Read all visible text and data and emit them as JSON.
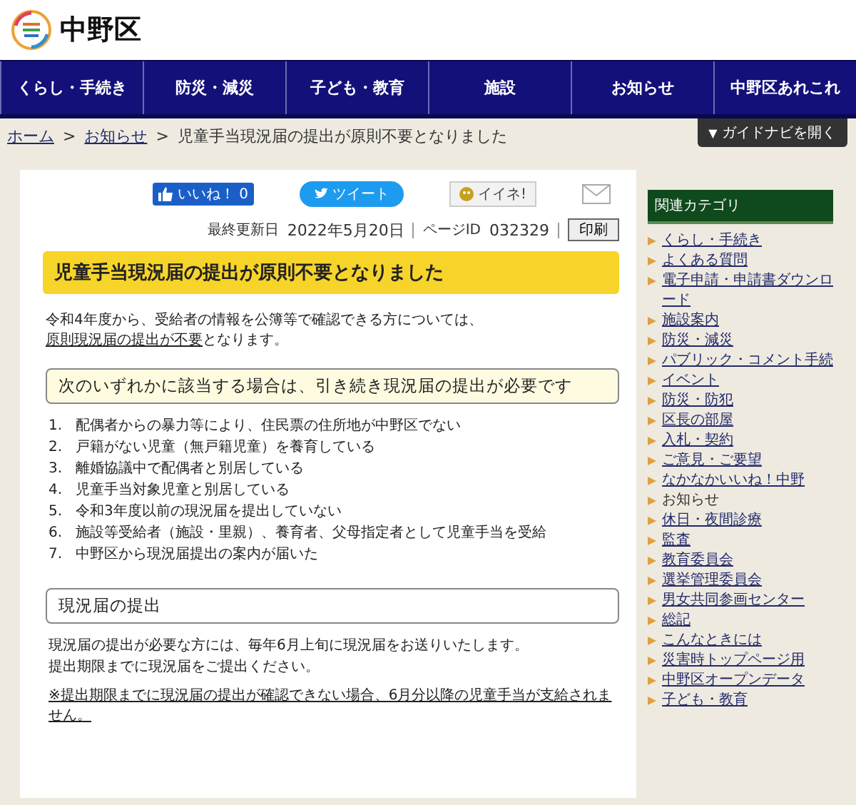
{
  "header": {
    "logo_text": "中野区"
  },
  "nav": [
    {
      "label": "くらし・手続き"
    },
    {
      "label": "防災・減災"
    },
    {
      "label": "子ども・教育"
    },
    {
      "label": "施設"
    },
    {
      "label": "お知らせ"
    },
    {
      "label": "中野区あれこれ"
    }
  ],
  "breadcrumb": [
    {
      "label": "ホーム",
      "kind": "link"
    },
    {
      "label": "お知らせ",
      "kind": "link",
      "separator": ">"
    },
    {
      "label": "児童手当現況届の提出が原則不要となりました",
      "kind": "current",
      "separator": ">"
    }
  ],
  "guide_button": {
    "icon": "▼",
    "label": "ガイドナビを開く"
  },
  "share": {
    "like_label": "いいね！",
    "like_count": "0",
    "tweet": "ツイート",
    "mixi": "イイネ!"
  },
  "meta": {
    "updated_label": "最終更新日",
    "updated": "2022年5月20日",
    "page_id_label": "ページID",
    "page_id": "032329",
    "print_button": "印刷"
  },
  "title": "児童手当現況届の提出が原則不要となりました",
  "intro": [
    {
      "text": "令和4年度から、受給者の情報を公簿等で確認できる方については、",
      "kind": "text"
    },
    {
      "text": "原則現況届の提出が不要",
      "kind": "link"
    },
    {
      "text": "となります。",
      "kind": "text"
    }
  ],
  "sections": [
    {
      "heading": "次のいずれかに該当する場合は、引き続き現況届の提出が必要です",
      "kind": "highlight",
      "items": [
        {
          "number": "1.",
          "text": "配偶者からの暴力等により、住民票の住所地が中野区でない"
        },
        {
          "number": "2.",
          "text": "戸籍がない児童（無戸籍児童）を養育している"
        },
        {
          "number": "3.",
          "text": "離婚協議中で配偶者と別居している"
        },
        {
          "number": "4.",
          "text": "児童手当対象児童と別居している"
        },
        {
          "number": "5.",
          "text": "令和3年度以前の現況届を提出していない"
        },
        {
          "number": "6.",
          "text": "施設等受給者（施設・里親）、養育者、父母指定者として児童手当を受給"
        },
        {
          "number": "7.",
          "text": "中野区から現況届提出の案内が届いた"
        }
      ]
    },
    {
      "heading": "現況届の提出",
      "kind": "plain",
      "paragraphs": [
        "現況届の提出が必要な方には、毎年6月上旬に現況届をお送りいたします。",
        "提出期限までに現況届をご提出ください。"
      ],
      "note": "※提出期限までに現況届の提出が確認できない場合、6月分以降の児童手当が支給されません。"
    }
  ],
  "sidebar": {
    "title": "関連カテゴリ",
    "items": [
      {
        "label": "くらし・手続き",
        "selected": false
      },
      {
        "label": "よくある質問",
        "selected": false
      },
      {
        "label": "電子申請・申請書ダウンロード",
        "selected": false
      },
      {
        "label": "施設案内",
        "selected": false
      },
      {
        "label": "防災・減災",
        "selected": false
      },
      {
        "label": "パブリック・コメント手続",
        "selected": false
      },
      {
        "label": "イベント",
        "selected": false
      },
      {
        "label": "防災・防犯",
        "selected": false
      },
      {
        "label": "区長の部屋",
        "selected": false
      },
      {
        "label": "入札・契約",
        "selected": false
      },
      {
        "label": "ご意見・ご要望",
        "selected": false
      },
      {
        "label": "なかなかいいね！中野",
        "selected": false
      },
      {
        "label": "お知らせ",
        "selected": true
      },
      {
        "label": "休日・夜間診療",
        "selected": false
      },
      {
        "label": "監査",
        "selected": false
      },
      {
        "label": "教育委員会",
        "selected": false
      },
      {
        "label": "選挙管理委員会",
        "selected": false
      },
      {
        "label": "男女共同参画センター",
        "selected": false
      },
      {
        "label": "総記",
        "selected": false
      },
      {
        "label": "こんなときには",
        "selected": false
      },
      {
        "label": "災害時トップページ用",
        "selected": false
      },
      {
        "label": "中野区オープンデータ",
        "selected": false
      },
      {
        "label": "子ども・教育",
        "selected": false
      }
    ]
  }
}
